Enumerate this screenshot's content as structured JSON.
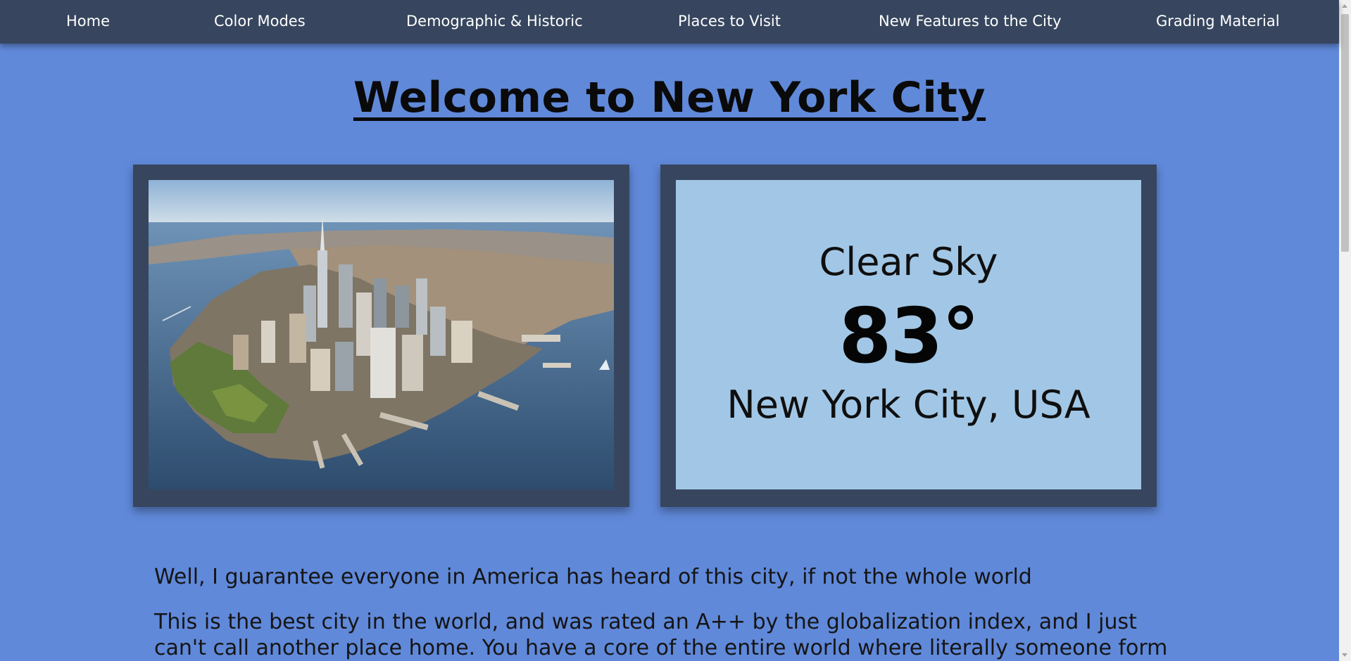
{
  "nav": {
    "items": [
      {
        "label": "Home"
      },
      {
        "label": "Color Modes"
      },
      {
        "label": "Demographic & Historic"
      },
      {
        "label": "Places to Visit"
      },
      {
        "label": "New Features to the City"
      },
      {
        "label": "Grading Material"
      }
    ]
  },
  "page": {
    "title": "Welcome to New York City"
  },
  "weather": {
    "condition": "Clear Sky",
    "temperature": "83°",
    "location": "New York City, USA"
  },
  "content": {
    "paragraph1": "Well, I guarantee everyone in America has heard of this city, if not the whole world",
    "paragraph2": "This is the best city in the world, and was rated an A++ by the globalization index, and I just can't call another place home. You have a core of the entire world where literally someone form all over"
  },
  "colors": {
    "background": "#6089da",
    "navbar": "#37465e",
    "weather_panel": "#a2c7e6"
  }
}
